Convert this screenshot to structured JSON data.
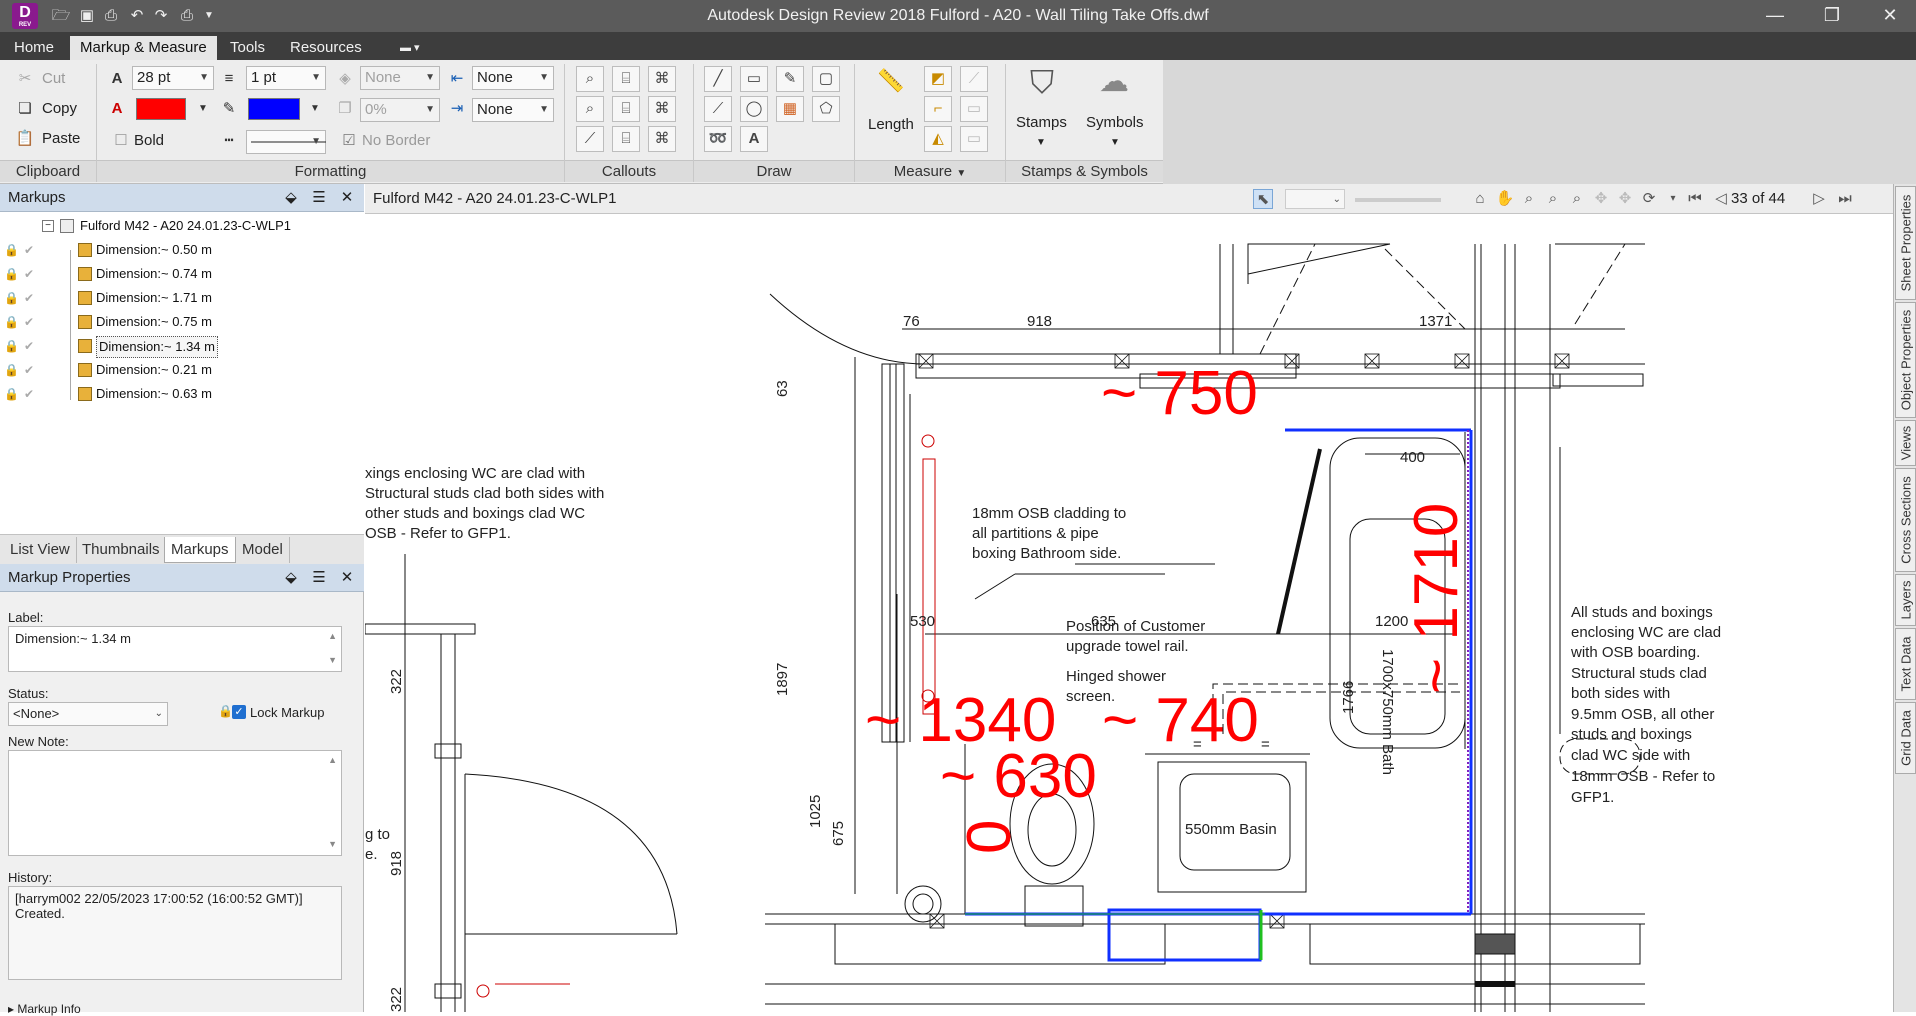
{
  "app": {
    "logo_letter": "D",
    "logo_sub": "REV",
    "window_title": "Autodesk Design Review 2018   Fulford  - A20 - Wall Tiling Take Offs.dwf"
  },
  "menu": {
    "tabs": [
      "Home",
      "Markup & Measure",
      "Tools",
      "Resources"
    ],
    "active": "Markup & Measure"
  },
  "ribbon": {
    "clipboard": {
      "cut": "Cut",
      "copy": "Copy",
      "paste": "Paste",
      "label": "Clipboard"
    },
    "formatting": {
      "font_size": "28 pt",
      "line_weight": "1 pt",
      "fill_pattern": "None",
      "transparency": "0%",
      "start_arrow": "None",
      "end_arrow": "None",
      "bold": "Bold",
      "no_border": "No Border",
      "text_color": "#ff0000",
      "line_color": "#0000ff",
      "label": "Formatting"
    },
    "callouts_label": "Callouts",
    "draw_label": "Draw",
    "measure": {
      "length": "Length",
      "label": "Measure"
    },
    "stamps": {
      "stamps": "Stamps",
      "symbols": "Symbols",
      "label": "Stamps & Symbols"
    }
  },
  "markups_panel": {
    "title": "Markups",
    "root": "Fulford  M42 - A20 24.01.23-C-WLP1",
    "items": [
      "Dimension:~ 0.50 m",
      "Dimension:~ 0.74 m",
      "Dimension:~ 1.71 m",
      "Dimension:~ 0.75 m",
      "Dimension:~ 1.34 m",
      "Dimension:~ 0.21 m",
      "Dimension:~ 0.63 m"
    ],
    "selected_index": 4
  },
  "panel_tabs": [
    "List View",
    "Thumbnails",
    "Markups",
    "Model"
  ],
  "active_panel_tab": "Markups",
  "properties": {
    "title": "Markup Properties",
    "label_caption": "Label:",
    "label_value": "Dimension:~ 1.34 m",
    "status_caption": "Status:",
    "status_value": "<None>",
    "lock_markup": "Lock Markup",
    "new_note_caption": "New Note:",
    "history_caption": "History:",
    "history_line1": "[harrym002  22/05/2023  17:00:52  (16:00:52 GMT)]",
    "history_line2": "Created.",
    "markup_info": "Markup Info"
  },
  "document": {
    "sheet_title": "Fulford  M42 - A20 24.01.23-C-WLP1",
    "page_counter": "33 of 44"
  },
  "side_tabs": [
    "Sheet Properties",
    "Object Properties",
    "Views",
    "Cross Sections",
    "Layers",
    "Text Data",
    "Grid Data"
  ],
  "drawing": {
    "notes_left": [
      "xings enclosing WC are clad with",
      "Structural studs clad both sides with",
      "other studs and boxings  clad WC",
      "OSB - Refer to GFP1."
    ],
    "note_osb": [
      "18mm OSB cladding to",
      "all partitions & pipe",
      "boxing Bathroom side."
    ],
    "note_towel": [
      "Position of Customer",
      "upgrade towel rail."
    ],
    "note_shower": [
      "Hinged shower",
      "screen."
    ],
    "note_right": [
      "All studs and boxings",
      "enclosing WC are clad",
      "with OSB boarding.",
      "Structural studs clad",
      "both sides with",
      "9.5mm OSB, all other",
      "studs and boxings",
      "clad WC side with",
      "18mm OSB - Refer to",
      "GFP1."
    ],
    "bath_label": "1700x750mm Bath",
    "basin_label": "550mm Basin",
    "partial_text_1": "g to",
    "partial_text_2": "e.",
    "dims": {
      "d76": "76",
      "d918_top": "918",
      "d1371": "1371",
      "d63": "63",
      "d400": "400",
      "d1897": "1897",
      "d530": "530",
      "d635": "635",
      "d1200": "1200",
      "d1766": "1766",
      "d1025": "1025",
      "d675": "675",
      "d322_top": "322",
      "d918_left": "918",
      "d322_bot": "322",
      "eq1": "=",
      "eq2": "="
    },
    "markups_text": {
      "m750": "~ 750",
      "m1710": "~ 1710",
      "m1340": "~ 1340",
      "m740": "~ 740",
      "m630": "~ 630",
      "m_small": "0"
    }
  }
}
